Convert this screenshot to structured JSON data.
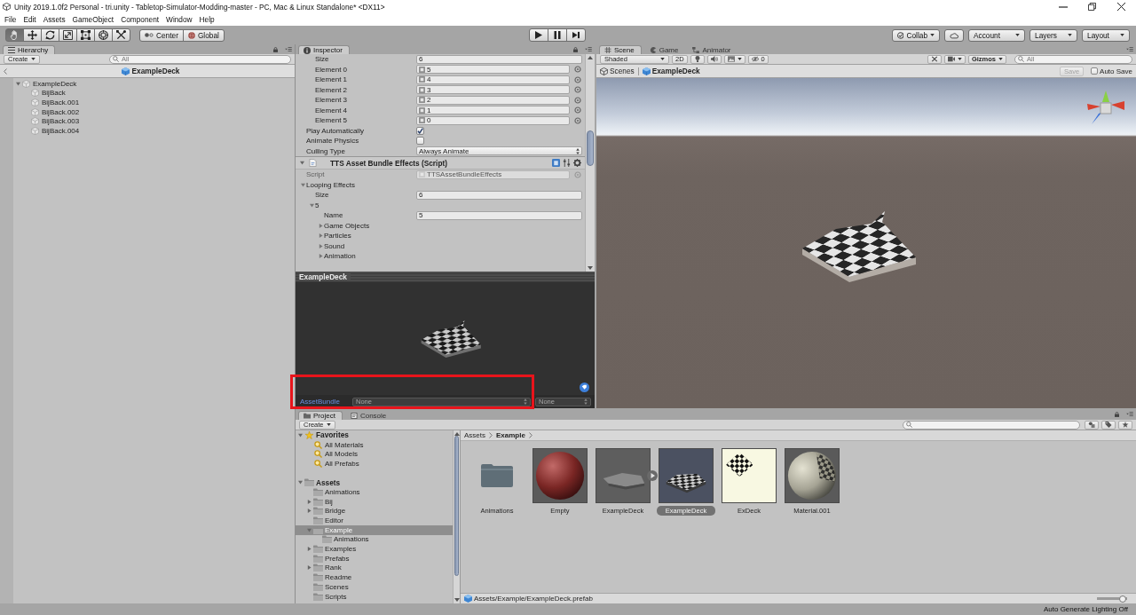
{
  "window": {
    "title": "Unity 2019.1.0f2 Personal - tri.unity - Tabletop-Simulator-Modding-master - PC, Mac & Linux Standalone* <DX11>"
  },
  "menu": [
    "File",
    "Edit",
    "Assets",
    "GameObject",
    "Component",
    "Window",
    "Help"
  ],
  "toolbar": {
    "tools": [
      {
        "kind": "hand",
        "selected": true
      },
      {
        "kind": "move",
        "selected": false
      },
      {
        "kind": "rotate",
        "selected": false
      },
      {
        "kind": "scale",
        "selected": false
      },
      {
        "kind": "rect",
        "selected": false
      },
      {
        "kind": "transform",
        "selected": false
      },
      {
        "kind": "custom",
        "selected": false
      }
    ],
    "pivot": [
      {
        "kind": "pivot",
        "label": "Center"
      },
      {
        "kind": "space",
        "label": "Global"
      }
    ],
    "playback": [
      {
        "kind": "play",
        "selected": false
      },
      {
        "kind": "pause",
        "selected": false
      },
      {
        "kind": "step",
        "selected": false
      }
    ],
    "collab": "Collab",
    "account": "Account",
    "layers": "Layers",
    "layout": "Layout"
  },
  "hierarchy": {
    "tab": "Hierarchy",
    "create": "Create",
    "search": {
      "placeholder": "All"
    },
    "breadcrumb": "ExampleDeck",
    "tree": [
      {
        "kind": "branch",
        "label": "ExampleDeck",
        "expanded": true,
        "selected": false,
        "children": [
          {
            "kind": "leaf",
            "label": "BijBack",
            "selected": false
          },
          {
            "kind": "leaf",
            "label": "BijBack.001",
            "selected": false
          },
          {
            "kind": "leaf",
            "label": "BijBack.002",
            "selected": false
          },
          {
            "kind": "leaf",
            "label": "BijBack.003",
            "selected": false
          },
          {
            "kind": "leaf",
            "label": "BijBack.004",
            "selected": false
          }
        ]
      }
    ]
  },
  "inspector": {
    "tab": "Inspector",
    "list_items": [
      {
        "kind": "number",
        "label": "Size",
        "value": "6"
      },
      {
        "kind": "object",
        "label": "Element 0",
        "value": "5"
      },
      {
        "kind": "object",
        "label": "Element 1",
        "value": "4"
      },
      {
        "kind": "object",
        "label": "Element 2",
        "value": "3"
      },
      {
        "kind": "object",
        "label": "Element 3",
        "value": "2"
      },
      {
        "kind": "object",
        "label": "Element 4",
        "value": "1"
      },
      {
        "kind": "object",
        "label": "Element 5",
        "value": "0"
      }
    ],
    "properties": [
      {
        "kind": "checkbox",
        "label": "Play Automatically",
        "checked": true
      },
      {
        "kind": "checkbox",
        "label": "Animate Physics",
        "checked": false
      },
      {
        "kind": "dropdown",
        "label": "Culling Type",
        "value": "Always Animate"
      }
    ],
    "component": {
      "title": "TTS Asset Bundle Effects (Script)",
      "expanded": true,
      "fields": [
        {
          "kind": "script",
          "label": "Script",
          "value": "TTSAssetBundleEffects"
        },
        {
          "kind": "foldout",
          "label": "Looping Effects",
          "expanded": true,
          "children": [
            {
              "kind": "number",
              "label": "Size",
              "value": "6"
            },
            {
              "kind": "foldout",
              "label": "5",
              "expanded": true,
              "children": [
                {
                  "kind": "text",
                  "label": "Name",
                  "value": "5"
                },
                {
                  "kind": "foldout",
                  "label": "Game Objects",
                  "expanded": false
                },
                {
                  "kind": "foldout",
                  "label": "Particles",
                  "expanded": false
                },
                {
                  "kind": "foldout",
                  "label": "Sound",
                  "expanded": false
                },
                {
                  "kind": "foldout",
                  "label": "Animation",
                  "expanded": false
                }
              ]
            }
          ]
        }
      ]
    },
    "preview": {
      "title": "ExampleDeck",
      "asset_bundle": {
        "label": "AssetBundle",
        "value": "None",
        "variant": "None"
      }
    }
  },
  "scene": {
    "tabs": [
      {
        "kind": "scene",
        "label": "Scene",
        "selected": true
      },
      {
        "kind": "game",
        "label": "Game",
        "selected": false
      },
      {
        "kind": "animator",
        "label": "Animator",
        "selected": false
      }
    ],
    "toolbar": {
      "draw_mode": "Shaded",
      "mode_2d": {
        "label": "2D",
        "selected": false
      },
      "lighting": {
        "selected": false
      },
      "audio": {
        "selected": false
      },
      "hidden_count": "0",
      "gizmos": "Gizmos",
      "search": {
        "placeholder": "All"
      }
    },
    "breadcrumb": {
      "root": "Scenes",
      "prefab": "ExampleDeck"
    },
    "save": {
      "label": "Save",
      "disabled": true
    },
    "auto_save": {
      "label": "Auto Save",
      "checked": false
    }
  },
  "project": {
    "tabs": [
      {
        "kind": "project",
        "label": "Project",
        "selected": true
      },
      {
        "kind": "console",
        "label": "Console",
        "selected": false
      }
    ],
    "create": "Create",
    "favorites": {
      "kind": "branch",
      "label": "Favorites",
      "expanded": true,
      "selected": false,
      "children": [
        {
          "kind": "leaf",
          "label": "All Materials",
          "selected": false
        },
        {
          "kind": "leaf",
          "label": "All Models",
          "selected": false
        },
        {
          "kind": "leaf",
          "label": "All Prefabs",
          "selected": false
        }
      ]
    },
    "assets": {
      "kind": "branch",
      "label": "Assets",
      "expanded": true,
      "selected": false,
      "children": [
        {
          "kind": "leaf",
          "label": "Animations",
          "selected": false
        },
        {
          "kind": "branch",
          "label": "Bij",
          "expanded": false,
          "selected": false
        },
        {
          "kind": "branch",
          "label": "Bridge",
          "expanded": false,
          "selected": false
        },
        {
          "kind": "leaf",
          "label": "Editor",
          "selected": false
        },
        {
          "kind": "branch",
          "label": "Example",
          "expanded": true,
          "selected": true,
          "children": [
            {
              "kind": "leaf",
              "label": "Animations",
              "selected": false
            }
          ]
        },
        {
          "kind": "branch",
          "label": "Examples",
          "expanded": false,
          "selected": false
        },
        {
          "kind": "leaf",
          "label": "Prefabs",
          "selected": false
        },
        {
          "kind": "branch",
          "label": "Rank",
          "expanded": false,
          "selected": false
        },
        {
          "kind": "leaf",
          "label": "Readme",
          "selected": false
        },
        {
          "kind": "leaf",
          "label": "Scenes",
          "selected": false
        },
        {
          "kind": "leaf",
          "label": "Scripts",
          "selected": false
        }
      ]
    },
    "breadcrumb": [
      "Assets",
      "Example"
    ],
    "items": [
      {
        "kind": "folder",
        "label": "Animations",
        "selected": false
      },
      {
        "kind": "material",
        "label": "Empty",
        "selected": false
      },
      {
        "kind": "model",
        "label": "ExampleDeck",
        "selected": false
      },
      {
        "kind": "prefab",
        "label": "ExampleDeck",
        "selected": true
      },
      {
        "kind": "texture",
        "label": "ExDeck",
        "selected": false
      },
      {
        "kind": "texturedmaterial",
        "label": "Material.001",
        "selected": false
      }
    ],
    "path": "Assets/Example/ExampleDeck.prefab",
    "icon_size": {
      "level": 0.95
    }
  },
  "status_bar": {
    "text": "Auto Generate Lighting Off"
  }
}
